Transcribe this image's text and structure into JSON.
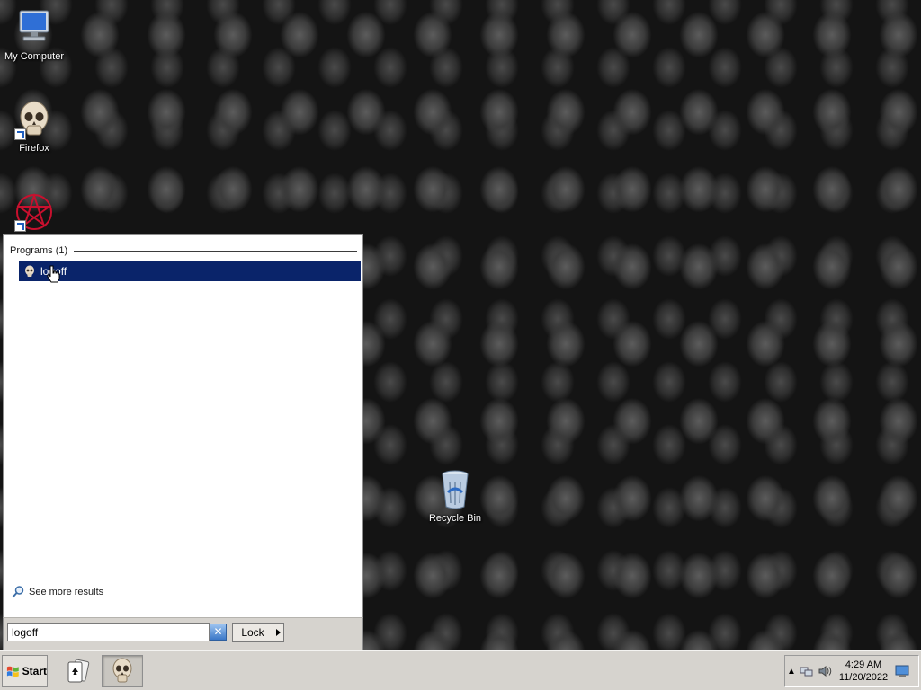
{
  "desktop": {
    "icons": [
      {
        "label": "My Computer",
        "icon": "computer-icon"
      },
      {
        "label": "Firefox",
        "icon": "skull-icon"
      },
      {
        "label": "",
        "icon": "pentagram-icon"
      },
      {
        "label": "Recycle Bin",
        "icon": "recycle-bin-icon"
      }
    ]
  },
  "start_menu": {
    "section_header": "Programs (1)",
    "results": [
      {
        "label": "logoff",
        "icon": "skull-icon",
        "selected": true
      }
    ],
    "see_more": "See more results",
    "search": {
      "value": "logoff"
    },
    "clear_icon": "clear-search-icon",
    "lock_label": "Lock"
  },
  "taskbar": {
    "start_label": "Start",
    "clock_time": "4:29 AM",
    "clock_date": "11/20/2022",
    "tray_icons": [
      "network-icon",
      "volume-icon",
      "action-center-icon"
    ]
  },
  "colors": {
    "selection": "#0a246a",
    "taskbar": "#d6d3ce",
    "wallpaper": "#141414"
  }
}
